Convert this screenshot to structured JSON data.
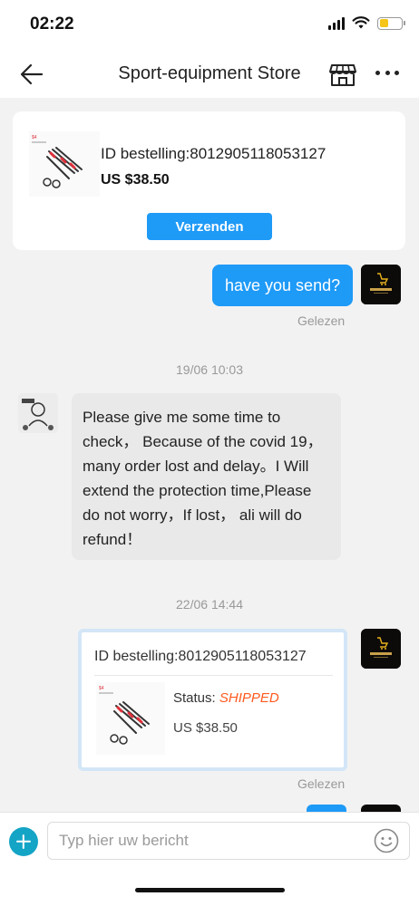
{
  "status_bar": {
    "time": "02:22"
  },
  "nav": {
    "title": "Sport-equipment Store"
  },
  "order_card": {
    "id_text": "ID bestelling:8012905118053127",
    "price": "US $38.50",
    "send_label": "Verzenden"
  },
  "messages": {
    "sent_text": "have you send?",
    "sent_read": "Gelezen",
    "timestamp_1": "19/06 10:03",
    "received_text": "Please give me some time to check， Because of the covid 19， many order lost and delay。I Will extend the protection time,Please do not worry，If lost， ali will do refund！",
    "timestamp_2": "22/06 14:44",
    "shipment_card": {
      "id_text": "ID bestelling:8012905118053127",
      "status_label": "Status: ",
      "status_value": "SHIPPED",
      "price": "US $38.50"
    },
    "shipment_read": "Gelezen"
  },
  "input": {
    "placeholder": "Typ hier uw bericht"
  },
  "colors": {
    "accent": "#1e9af7",
    "status_shipped": "#ff5a1f",
    "plus_button": "#14a4c6",
    "chat_background": "#f2f2f2"
  },
  "icons": {
    "back": "arrow-left-icon",
    "store": "store-icon",
    "more": "more-dots-icon",
    "add": "plus-icon",
    "emoji": "emoji-icon"
  }
}
